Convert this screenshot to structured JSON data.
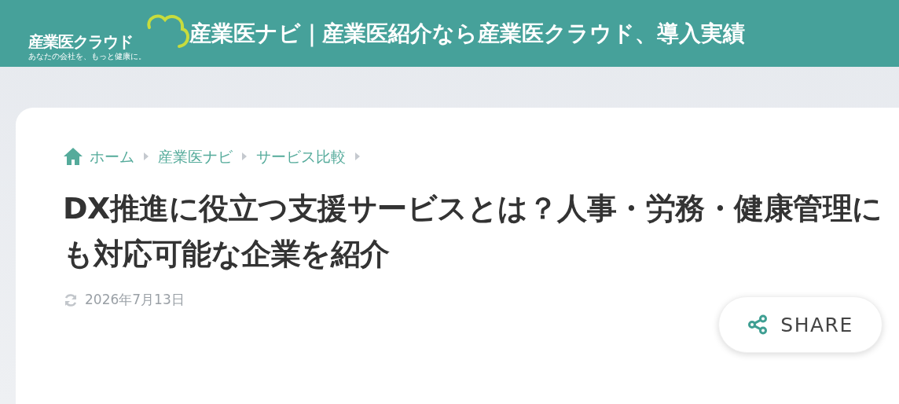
{
  "header": {
    "logo_text": "産業医クラウド",
    "logo_tagline": "あなたの会社を、もっと健康に。",
    "title": "産業医ナビ｜産業医紹介なら産業医クラウド、導入実績"
  },
  "breadcrumb": [
    {
      "label": "ホーム",
      "kind": "home"
    },
    {
      "label": "産業医ナビ",
      "kind": "link"
    },
    {
      "label": "サービス比較",
      "kind": "link"
    }
  ],
  "article": {
    "title": "DX推進に役立つ支援サービスとは？人事・労務・健康管理にも対応可能な企業を紹介",
    "updated": "2026年7月13日"
  },
  "share_button": {
    "label": "SHARE"
  }
}
